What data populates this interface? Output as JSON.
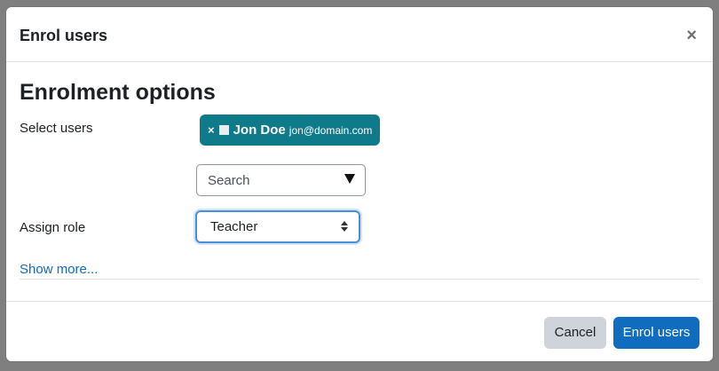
{
  "dialog": {
    "title": "Enrol users",
    "close_glyph": "×",
    "close_icon": "close-icon"
  },
  "form": {
    "section_title": "Enrolment options",
    "select_users_label": "Select users",
    "selected_user": {
      "remove_glyph": "×",
      "name": "Jon Doe",
      "email": "jon@domain.com",
      "chip_color": "#0f7b8a"
    },
    "search_placeholder": "Search",
    "assign_role_label": "Assign role",
    "role_value": "Teacher",
    "show_more": "Show more..."
  },
  "footer": {
    "cancel_label": "Cancel",
    "enrol_label": "Enrol users",
    "primary_color": "#0f6cbf"
  }
}
